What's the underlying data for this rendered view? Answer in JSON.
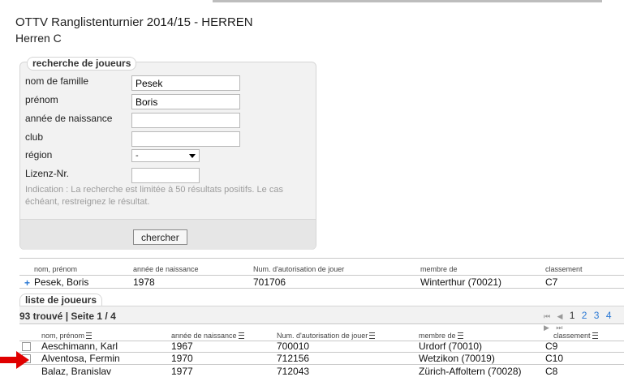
{
  "page": {
    "title": "OTTV Ranglistenturnier 2014/15 - HERREN",
    "subtitle": "Herren C"
  },
  "search": {
    "legend": "recherche de joueurs",
    "fields": {
      "last_name_label": "nom de famille",
      "last_name_value": "Pesek",
      "first_name_label": "prénom",
      "first_name_value": "Boris",
      "birth_year_label": "année de naissance",
      "birth_year_value": "",
      "club_label": "club",
      "club_value": "",
      "region_label": "région",
      "region_value": "-",
      "license_label": "Lizenz-Nr.",
      "license_value": ""
    },
    "hint": "Indication : La recherche est limitée à 50 résultats positifs. Le cas échéant, restreignez le résultat.",
    "button_label": "chercher"
  },
  "selected": {
    "headers": {
      "name": "nom, prénom",
      "birth_year": "année de naissance",
      "license": "Num. d'autorisation de jouer",
      "member": "membre de",
      "ranking": "classement"
    },
    "row": {
      "marker": "+",
      "name": "Pesek, Boris",
      "birth_year": "1978",
      "license": "701706",
      "member": "Winterthur (70021)",
      "ranking": "C7"
    }
  },
  "player_list": {
    "legend": "liste de joueurs",
    "count": "93 trouvé | Seite 1 / 4",
    "pager": {
      "first": "⏮",
      "prev": "◀",
      "pages": [
        "1",
        "2",
        "3",
        "4"
      ],
      "next": "▶",
      "last": "⏭"
    },
    "headers": {
      "name": "nom, prénom",
      "birth_year": "année de naissance",
      "license": "Num. d'autorisation de jouer",
      "member": "membre de",
      "ranking": "classement"
    },
    "rows": [
      {
        "name": "Aeschimann, Karl",
        "birth_year": "1967",
        "license": "700010",
        "member": "Urdorf (70010)",
        "ranking": "C9"
      },
      {
        "name": "Alventosa, Fermin",
        "birth_year": "1970",
        "license": "712156",
        "member": "Wetzikon (70019)",
        "ranking": "C10"
      },
      {
        "name": "Balaz, Branislav",
        "birth_year": "1977",
        "license": "712043",
        "member": "Zürich-Affoltern (70028)",
        "ranking": "C8"
      }
    ]
  },
  "colors": {
    "accent": "#2a78d4",
    "arrow": "#e00000",
    "panel": "#f2f2f2"
  }
}
